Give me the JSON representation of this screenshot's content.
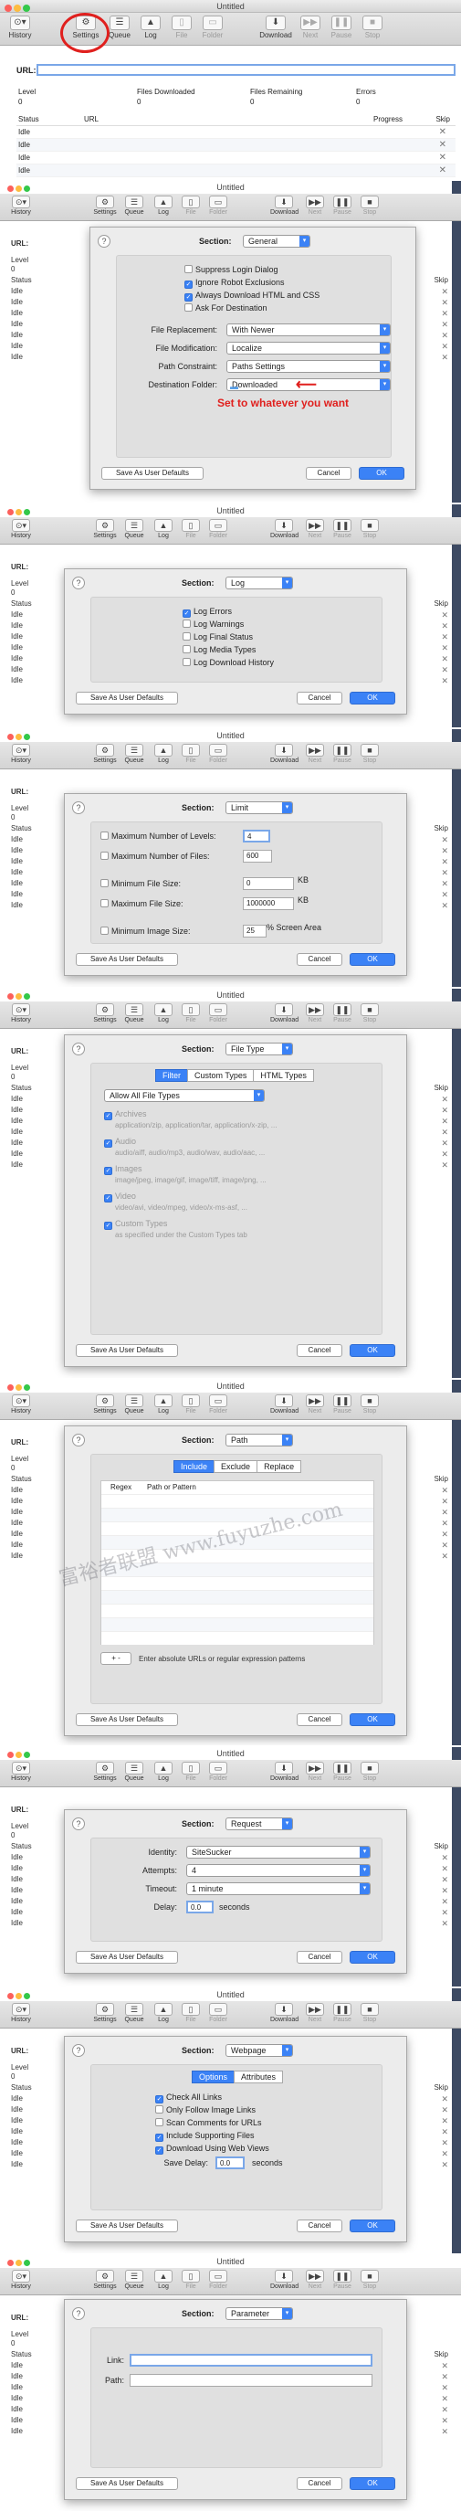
{
  "app": {
    "title": "Untitled"
  },
  "toolbar": {
    "history": "History",
    "settings": "Settings",
    "queue": "Queue",
    "log": "Log",
    "file": "File",
    "folder": "Folder",
    "download": "Download",
    "next": "Next",
    "pause": "Pause",
    "stop": "Stop"
  },
  "url_label": "URL:",
  "stats": {
    "level": "Level",
    "files_downloaded": "Files Downloaded",
    "files_remaining": "Files Remaining",
    "errors": "Errors",
    "level_val": "0",
    "files_downloaded_val": "0",
    "files_remaining_val": "0",
    "errors_val": "0"
  },
  "table": {
    "status": "Status",
    "url": "URL",
    "progress": "Progress",
    "skip": "Skip",
    "idle": "Idle"
  },
  "common": {
    "section": "Section:",
    "save_defaults": "Save As User Defaults",
    "cancel": "Cancel",
    "ok": "OK",
    "help": "?"
  },
  "general": {
    "section_value": "General",
    "suppress_login": "Suppress Login Dialog",
    "ignore_robot": "Ignore Robot Exclusions",
    "always_download": "Always Download HTML and CSS",
    "ask_destination": "Ask For Destination",
    "file_replacement_label": "File Replacement:",
    "file_replacement_value": "With Newer",
    "file_modification_label": "File Modification:",
    "file_modification_value": "Localize",
    "path_constraint_label": "Path Constraint:",
    "path_constraint_value": "Paths Settings",
    "destination_label": "Destination Folder:",
    "destination_value": "Downloaded",
    "annotation": "Set to whatever you want"
  },
  "log": {
    "section_value": "Log",
    "log_errors": "Log Errors",
    "log_warnings": "Log Warnings",
    "log_final": "Log Final Status",
    "log_media": "Log Media Types",
    "log_history": "Log Download History"
  },
  "limit": {
    "section_value": "Limit",
    "max_levels": "Maximum Number of Levels:",
    "max_levels_val": "4",
    "max_files": "Maximum Number of Files:",
    "max_files_val": "600",
    "min_file_size": "Minimum File Size:",
    "min_file_size_val": "0",
    "max_file_size": "Maximum File Size:",
    "max_file_size_val": "1000000",
    "kb": "KB",
    "min_image": "Minimum Image Size:",
    "min_image_val": "25",
    "screen_area": "% Screen Area"
  },
  "filetype": {
    "section_value": "File Type",
    "tab_filter": "Filter",
    "tab_custom": "Custom Types",
    "tab_html": "HTML Types",
    "allow_all": "Allow All File Types",
    "archives": "Archives",
    "archives_sub": "application/zip, application/tar, application/x-zip, ...",
    "audio": "Audio",
    "audio_sub": "audio/aiff, audio/mp3, audio/wav, audio/aac, ...",
    "images": "Images",
    "images_sub": "image/jpeg, image/gif, image/tiff, image/png, ...",
    "video": "Video",
    "video_sub": "video/avi, video/mpeg, video/x-ms-asf, ...",
    "custom": "Custom Types",
    "custom_sub": "as specified under the Custom Types tab"
  },
  "path": {
    "section_value": "Path",
    "tab_include": "Include",
    "tab_exclude": "Exclude",
    "tab_replace": "Replace",
    "col_regex": "Regex",
    "col_path": "Path or Pattern",
    "hint": "Enter absolute URLs or regular expression patterns",
    "plus_minus": "+  -"
  },
  "request": {
    "section_value": "Request",
    "identity_label": "Identity:",
    "identity_value": "SiteSucker",
    "attempts_label": "Attempts:",
    "attempts_value": "4",
    "timeout_label": "Timeout:",
    "timeout_value": "1 minute",
    "delay_label": "Delay:",
    "delay_value": "0.0",
    "seconds": "seconds"
  },
  "webpage": {
    "section_value": "Webpage",
    "tab_options": "Options",
    "tab_attributes": "Attributes",
    "check_all_links": "Check All Links",
    "only_follow_image": "Only Follow Image Links",
    "scan_comments": "Scan Comments for URLs",
    "include_supporting": "Include Supporting Files",
    "download_web_views": "Download Using Web Views",
    "save_delay_label": "Save Delay:",
    "save_delay_value": "0.0",
    "seconds": "seconds"
  },
  "parameter": {
    "section_value": "Parameter",
    "link_label": "Link:",
    "path_label": "Path:"
  },
  "watermark": "富裕者联盟 www.fuyuzhe.com",
  "colors": {
    "accent": "#3b82f6",
    "annotation": "#e0201e",
    "desktop": "#3d4a63"
  }
}
